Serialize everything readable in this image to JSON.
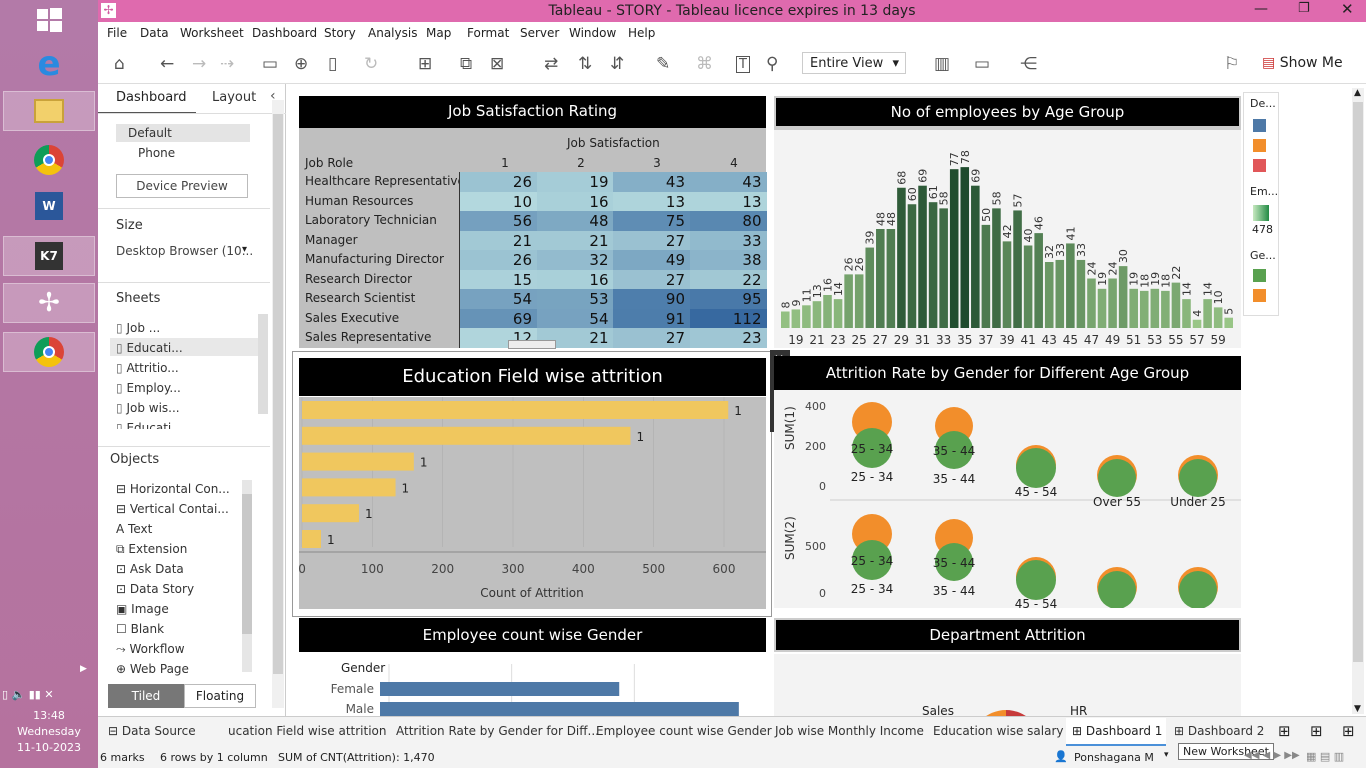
{
  "taskbar": {
    "time": "13:48",
    "day": "Wednesday",
    "date": "11-10-2023"
  },
  "window": {
    "title": "Tableau - STORY - Tableau licence expires in 13 days"
  },
  "menu": [
    "File",
    "Data",
    "Worksheet",
    "Dashboard",
    "Story",
    "Analysis",
    "Map",
    "Format",
    "Server",
    "Window",
    "Help"
  ],
  "toolbar": {
    "view": "Entire View",
    "show_me": "Show Me"
  },
  "left": {
    "tab_dashboard": "Dashboard",
    "tab_layout": "Layout",
    "default": "Default",
    "phone": "Phone",
    "device_preview": "Device Preview",
    "size_title": "Size",
    "size_value": "Desktop Browser (10...",
    "sheets_title": "Sheets",
    "sheets": [
      "Job ...",
      "Educati...",
      "Attritio...",
      "Employ...",
      "Job wis...",
      "Educati..."
    ],
    "objects_title": "Objects",
    "objects": [
      "Horizontal Con...",
      "Vertical Contai...",
      "Text",
      "Extension",
      "Ask Data",
      "Data Story",
      "Image",
      "Blank",
      "Workflow",
      "Web Page"
    ],
    "tiled": "Tiled",
    "floating": "Floating"
  },
  "panels": {
    "job": "Job Satisfaction Rating",
    "age": "No of employees by Age Group",
    "edu": "Education Field wise attrition",
    "gender_age": "Attrition Rate by Gender for Different Age Group",
    "emp_gender": "Employee count wise Gender",
    "dept": "Department  Attrition"
  },
  "job_table": {
    "col_header": "Job Satisfaction",
    "row_header": "Job Role",
    "cols": [
      "1",
      "2",
      "3",
      "4"
    ],
    "rows": [
      [
        "Healthcare Representative",
        "26",
        "19",
        "43",
        "43"
      ],
      [
        "Human Resources",
        "10",
        "16",
        "13",
        "13"
      ],
      [
        "Laboratory Technician",
        "56",
        "48",
        "75",
        "80"
      ],
      [
        "Manager",
        "21",
        "21",
        "27",
        "33"
      ],
      [
        "Manufacturing Director",
        "26",
        "32",
        "49",
        "38"
      ],
      [
        "Research Director",
        "15",
        "16",
        "27",
        "22"
      ],
      [
        "Research Scientist",
        "54",
        "53",
        "90",
        "95"
      ],
      [
        "Sales Executive",
        "69",
        "54",
        "91",
        "112"
      ],
      [
        "Sales Representative",
        "12",
        "21",
        "27",
        "23"
      ]
    ]
  },
  "chart_data": [
    {
      "type": "bar",
      "title": "No of employees by Age Group",
      "x": [
        18,
        19,
        20,
        21,
        22,
        23,
        24,
        25,
        26,
        27,
        28,
        29,
        30,
        31,
        32,
        33,
        34,
        35,
        36,
        37,
        38,
        39,
        40,
        41,
        42,
        43,
        44,
        45,
        46,
        47,
        48,
        49,
        50,
        51,
        52,
        53,
        54,
        55,
        56,
        57,
        58,
        59,
        60
      ],
      "values": [
        8,
        9,
        11,
        13,
        16,
        14,
        26,
        26,
        39,
        48,
        48,
        68,
        60,
        69,
        61,
        58,
        77,
        78,
        69,
        50,
        58,
        42,
        57,
        40,
        46,
        32,
        33,
        41,
        33,
        24,
        19,
        24,
        30,
        19,
        18,
        19,
        18,
        22,
        14,
        4,
        14,
        10,
        5
      ],
      "xticks": [
        "19",
        "21",
        "23",
        "25",
        "27",
        "29",
        "31",
        "33",
        "35",
        "37",
        "39",
        "41",
        "43",
        "45",
        "47",
        "49",
        "51",
        "53",
        "55",
        "57",
        "59"
      ]
    },
    {
      "type": "bar",
      "title": "Education Field wise attrition",
      "orientation": "horizontal",
      "values": [
        606,
        467,
        159,
        133,
        81,
        27
      ],
      "labels": [
        "1",
        "1",
        "1",
        "1",
        "1",
        "1"
      ],
      "xlabel": "Count of Attrition",
      "xticks": [
        "0",
        "100",
        "200",
        "300",
        "400",
        "500",
        "600"
      ]
    },
    {
      "type": "scatter",
      "title": "Attrition Rate by Gender for Different Age Group",
      "categories": [
        "25 - 34",
        "35 - 44",
        "45 - 54",
        "Over 55",
        "Under 25"
      ],
      "ylabel_top": "SUM(1)",
      "ylabel_bottom": "SUM(2)",
      "yticks_top": [
        "400",
        "200",
        "0"
      ],
      "yticks_bottom": [
        "500",
        "0"
      ]
    },
    {
      "type": "bar",
      "title": "Employee count wise Gender",
      "orientation": "horizontal",
      "categories": [
        "Female",
        "Male"
      ],
      "values": [
        588,
        882
      ],
      "axis_label": "Gender"
    }
  ],
  "dept": {
    "labels": [
      "Sales",
      "HR"
    ]
  },
  "legend": {
    "de": "De...",
    "em": "Em...",
    "em_val": "478",
    "ge": "Ge..."
  },
  "tabs": [
    "Data Source",
    "ucation Field wise attrition",
    "Attrition Rate by Gender for Diff...",
    "Employee count wise Gender",
    "Job wise Monthly Income",
    "Education wise salary",
    "Dashboard 1",
    "Dashboard 2"
  ],
  "status": {
    "marks": "6 marks",
    "rows": "6 rows by 1 column",
    "sum": "SUM of CNT(Attrition): 1,470",
    "user": "Ponshagana M",
    "tooltip": "New Worksheet"
  }
}
